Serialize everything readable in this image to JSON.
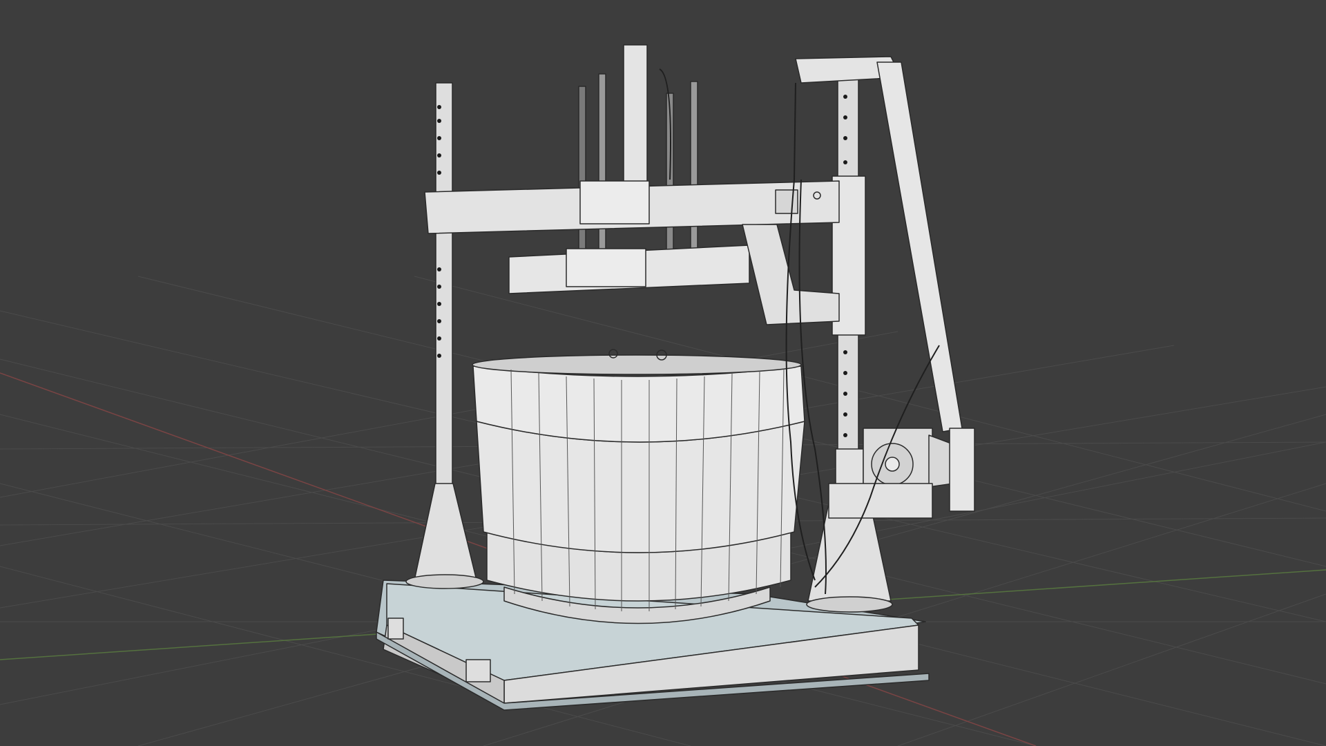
{
  "viewport": {
    "background_color": "#3d3d3d",
    "grid_color": "#4a4a4a",
    "x_axis_color": "#8a4a4a",
    "y_axis_color": "#5a7a4a",
    "model_fill_light": "#e6e6e6",
    "model_fill_mid": "#cfcfcf",
    "base_plate_color": "#b8c4c8",
    "wire_color": "#2a2a2a"
  },
  "model": {
    "name_icon": "machine-model-icon",
    "type": "cylindrical-press-machine"
  }
}
